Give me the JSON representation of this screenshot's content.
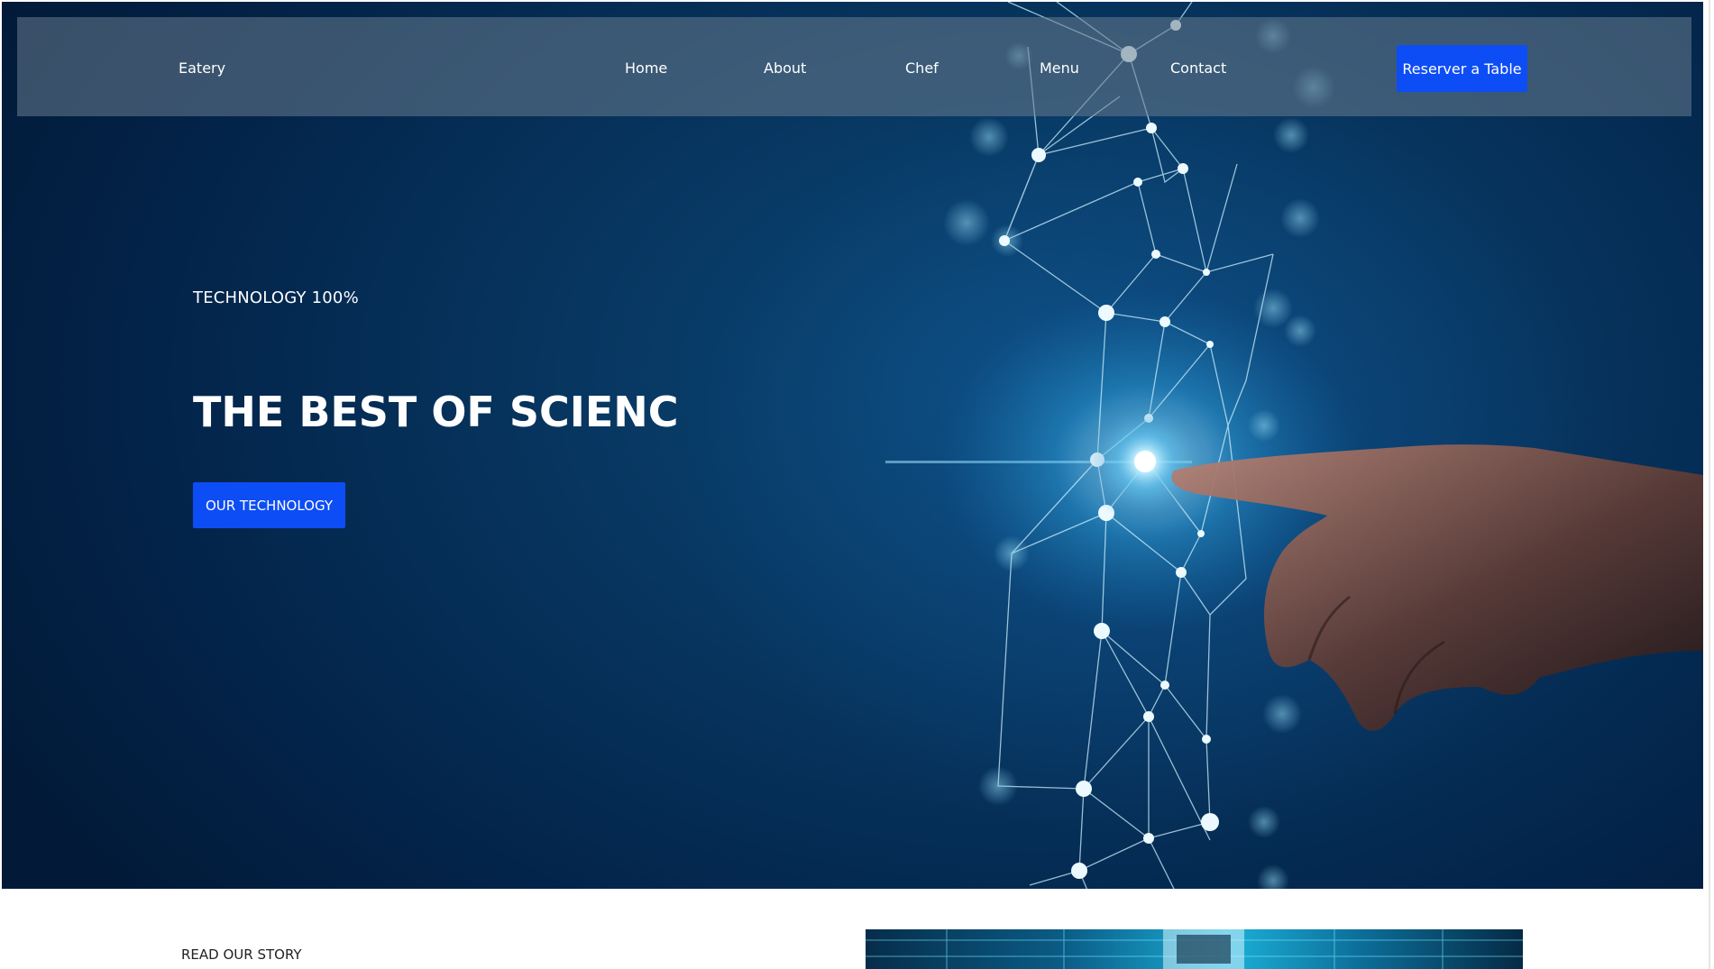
{
  "navbar": {
    "brand": "Eatery",
    "links": [
      {
        "label": "Home"
      },
      {
        "label": "About"
      },
      {
        "label": "Chef"
      },
      {
        "label": "Menu"
      },
      {
        "label": "Contact"
      }
    ],
    "reserve_label": "Reserver a Table"
  },
  "hero": {
    "eyebrow": "TECHNOLOGY 100%",
    "headline": "THE BEST OF SCIENC",
    "cta_label": "OUR TECHNOLOGY",
    "image_subject": "hand touching glowing network of connected nodes"
  },
  "story": {
    "link_label": "READ OUR STORY",
    "image_subject": "futuristic cyan technology interior"
  },
  "colors": {
    "accent_button": "#0d4df5",
    "hero_background": "#03244a",
    "navbar_overlay": "#687c8e",
    "node_glow": "#dff6ff"
  }
}
